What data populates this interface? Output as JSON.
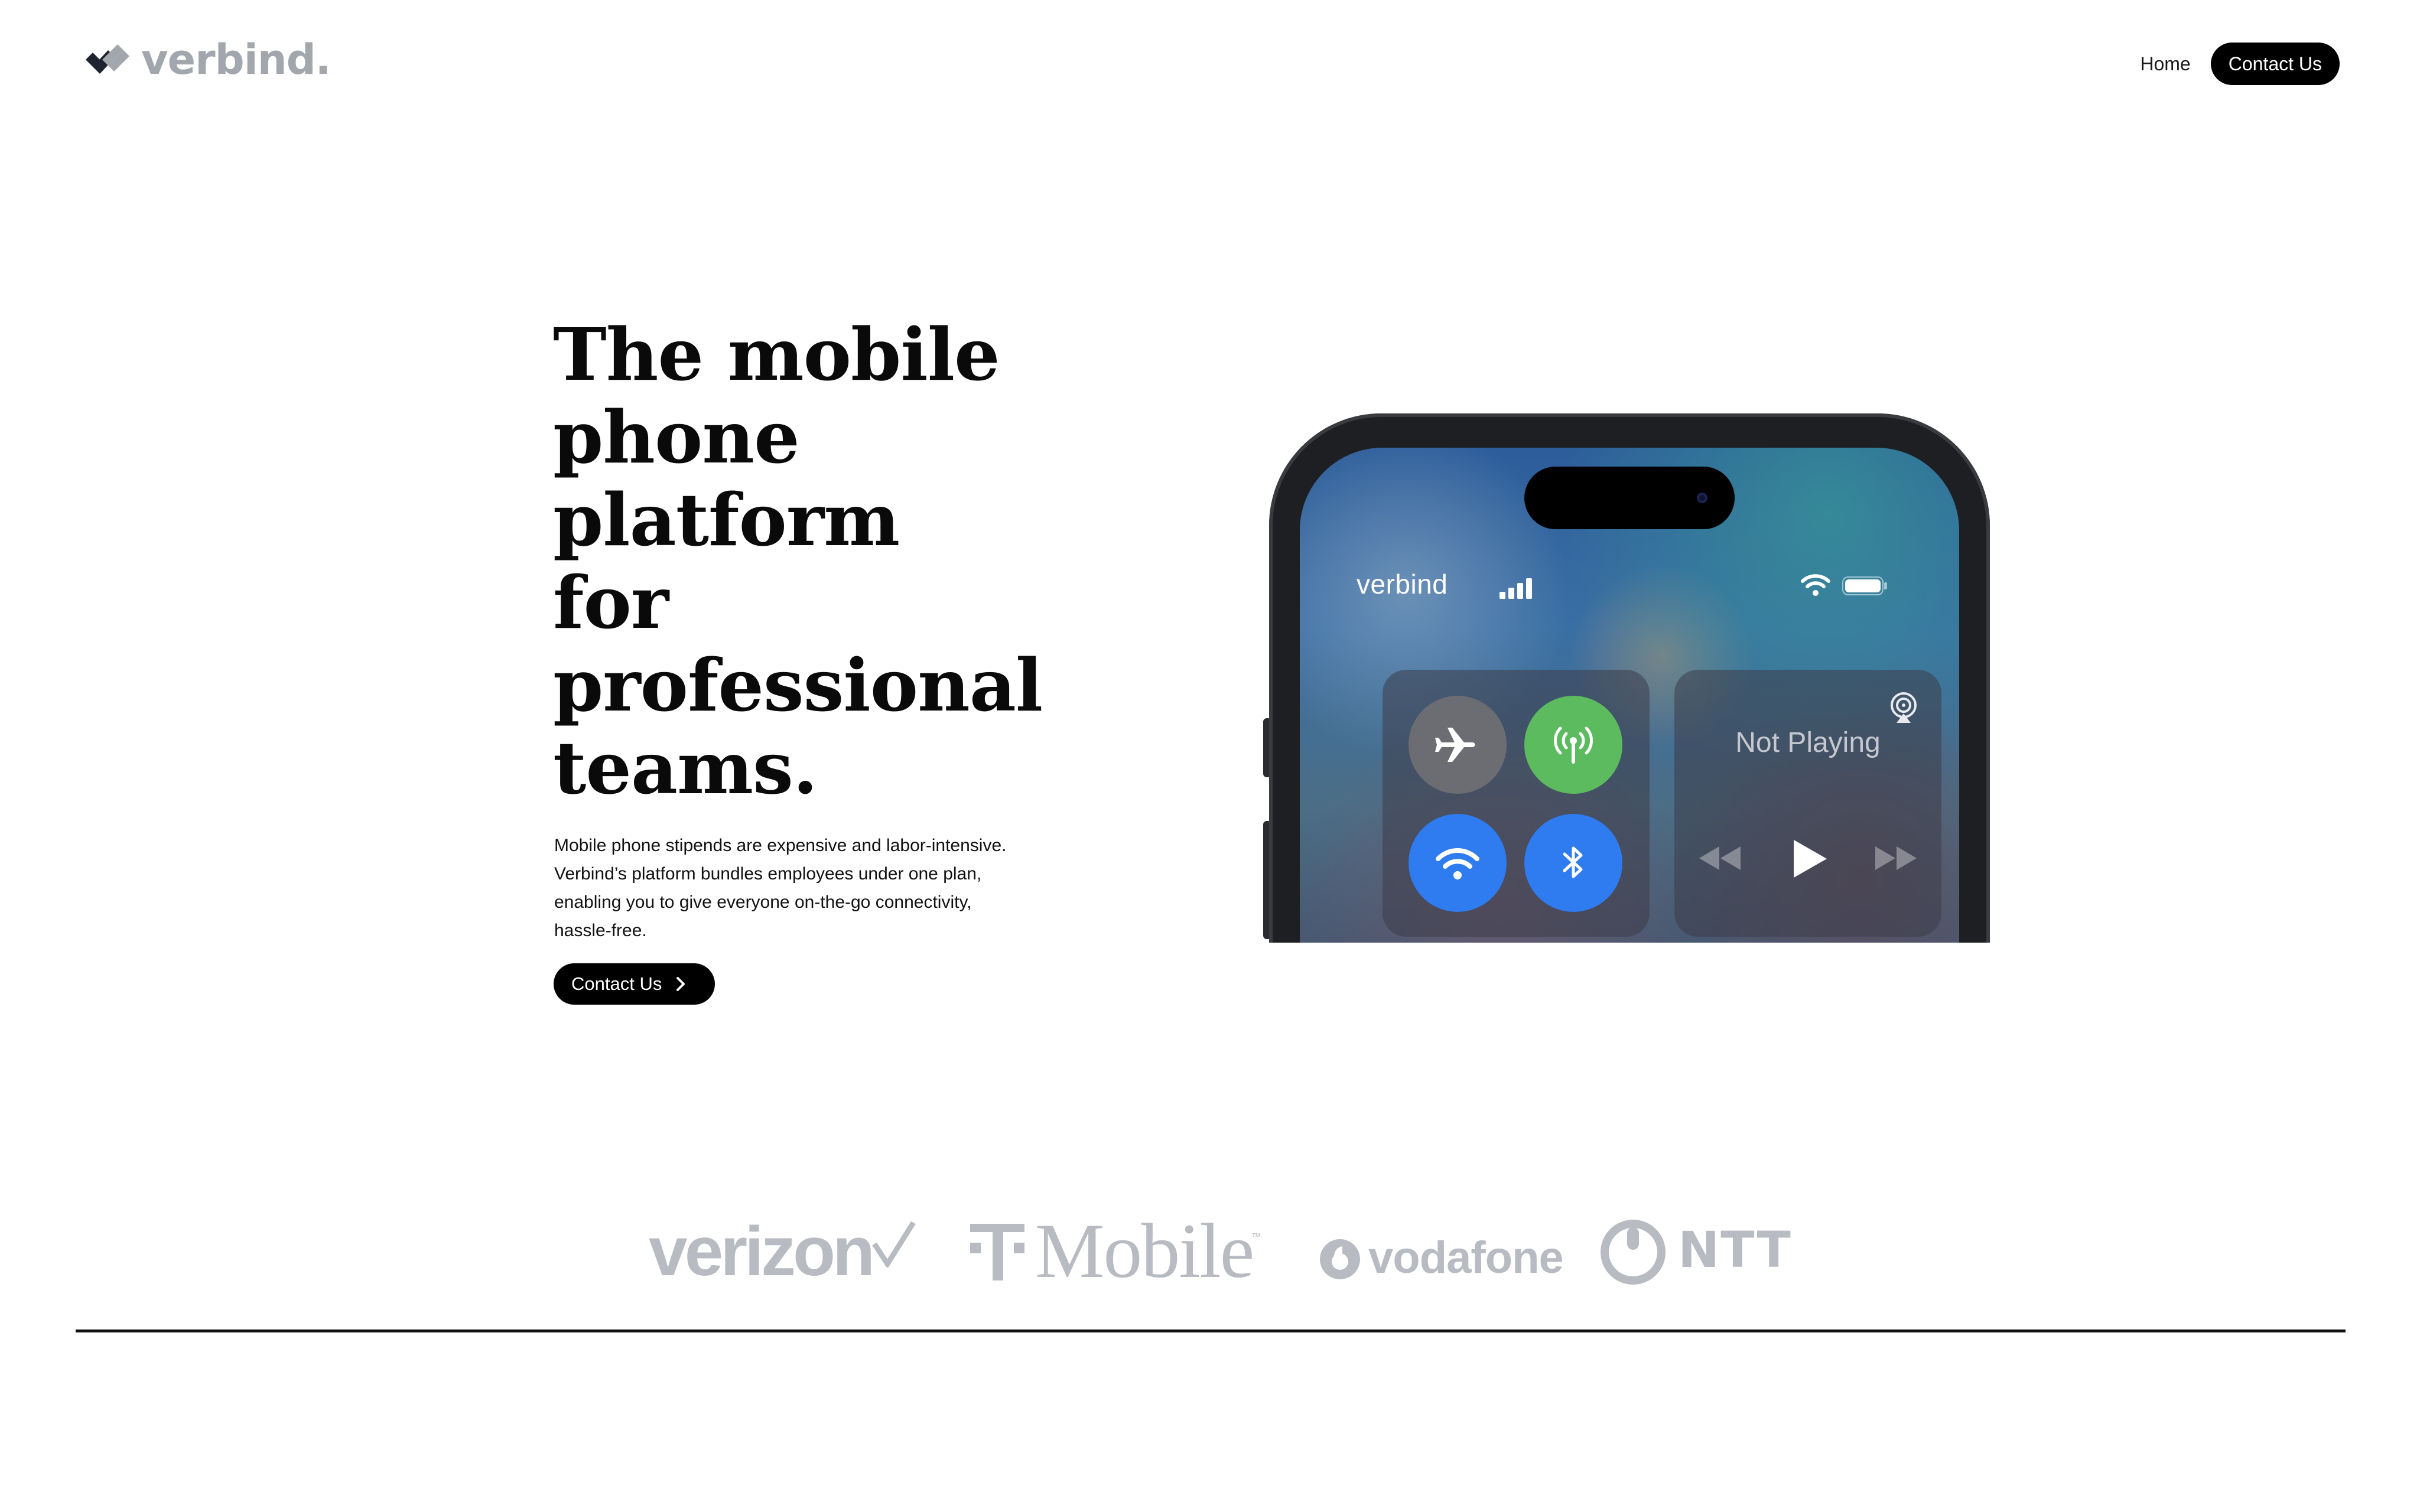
{
  "header": {
    "logo_text": "verbind.",
    "logo_icon": "double-check-icon",
    "nav": {
      "home_label": "Home",
      "contact_label": "Contact Us"
    }
  },
  "hero": {
    "title_lines": [
      "The mobile",
      "phone",
      "platform",
      "for",
      "professional",
      "teams."
    ],
    "description_lines": [
      "Mobile phone stipends are expensive and labor-intensive.",
      "Verbind’s platform bundles employees under one plan,",
      "enabling you to give everyone on-the-go connectivity,",
      "hassle-free."
    ],
    "cta_label": "Contact Us",
    "cta_icon": "chevron-right-icon"
  },
  "phone": {
    "carrier": "verbind",
    "status_icons": [
      "signal-bars-icon",
      "wifi-icon",
      "battery-icon"
    ],
    "controls": {
      "airplane_icon": "airplane-icon",
      "cellular_icon": "cellular-antenna-icon",
      "wifi_icon": "wifi-icon",
      "bluetooth_icon": "bluetooth-icon"
    },
    "media": {
      "status": "Not Playing",
      "icons": [
        "airplay-icon",
        "rewind-icon",
        "play-icon",
        "fast-forward-icon"
      ]
    }
  },
  "carriers": {
    "verizon": "verizon",
    "tmobile": "Mobile",
    "tmobile_tm": "™",
    "vodafone": "vodafone",
    "ntt": "NTT"
  },
  "colors": {
    "logo_gray": "#a2a6ad",
    "carrier_logo_gray": "#b8bbc2",
    "button_black": "#000000",
    "toggle_green": "#5cbb5e",
    "toggle_blue": "#2f7bf0",
    "toggle_gray": "#6c6d72"
  }
}
